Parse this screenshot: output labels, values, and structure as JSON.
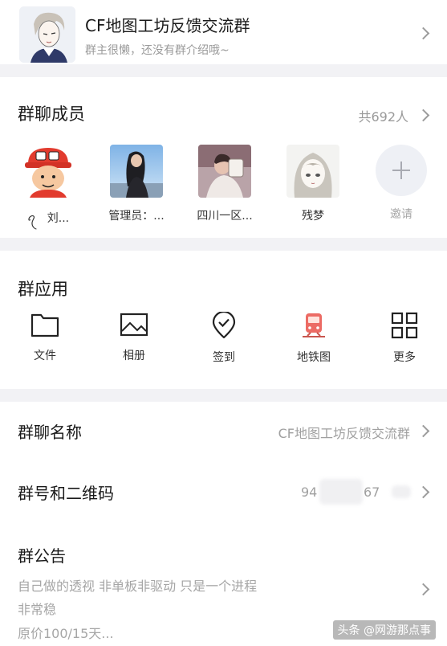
{
  "header": {
    "group_name": "CF地图工坊反馈交流群",
    "group_desc": "群主很懒，还没有群介绍哦~"
  },
  "members": {
    "title": "群聊成员",
    "count": "共692人",
    "list": [
      {
        "name": "ꪖ　刘..."
      },
      {
        "name": "管理员：..."
      },
      {
        "name": "四川一区..."
      },
      {
        "name": "残梦"
      }
    ],
    "invite_label": "邀请"
  },
  "apps": {
    "title": "群应用",
    "items": [
      {
        "label": "文件",
        "icon": "folder-icon"
      },
      {
        "label": "相册",
        "icon": "photo-album-icon"
      },
      {
        "label": "签到",
        "icon": "checkin-pin-icon"
      },
      {
        "label": "地铁图",
        "icon": "subway-icon"
      },
      {
        "label": "更多",
        "icon": "grid-more-icon"
      }
    ]
  },
  "settings": {
    "name_label": "群聊名称",
    "name_value": "CF地图工坊反馈交流群",
    "qr_label": "群号和二维码",
    "qr_prefix": "94",
    "qr_suffix": "67",
    "notice_label": "群公告",
    "notice_lines": [
      "自己做的透视 非单板非驱动 只是一个进程",
      "非常稳",
      "原价100/15天..."
    ]
  },
  "watermark": "头条 @网游那点事"
}
